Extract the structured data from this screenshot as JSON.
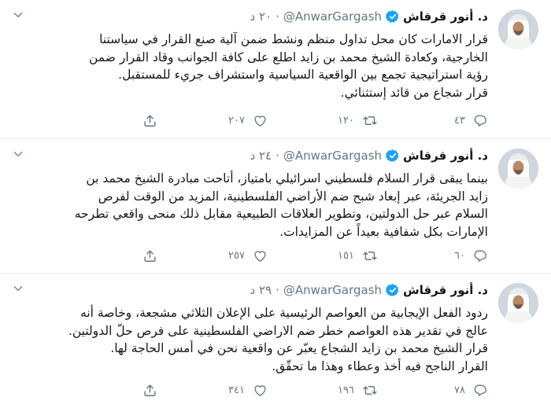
{
  "tweets": [
    {
      "name": "د. أنور قرقاش",
      "handle": "@AnwarGargash",
      "separator": "·",
      "time": "٢٠ د",
      "lines": [
        "قرار الامارات كان محل تداول منظم ونشط ضمن آلية صنع القرار في سياستنا",
        "الخارجية، وكعادة الشيخ محمد بن زايد اطلع على كافة الجوانب وقاد القرار ضمن",
        "رؤية استراتيجية تجمع بين الواقعية السياسية واستشراف جريء للمستقبل.",
        "قرار شجاع من قائد إستثنائي."
      ],
      "replies": "٤٣",
      "retweets": "١٢٠",
      "likes": "٢٠٧"
    },
    {
      "name": "د. أنور قرقاش",
      "handle": "@AnwarGargash",
      "separator": "·",
      "time": "٢٤ د",
      "lines": [
        "بينما يبقى قرار السلام فلسطيني اسرائيلي بامتياز، أتاحت مبادرة الشيخ محمد بن",
        "زايد الجريئة، عبر إبعاد شبح ضم الأراضي الفلسطينية، المزيد من الوقت لفرص",
        "السلام عبر حل الدولتين، وتطوير العلاقات الطبيعية مقابل ذلك منحى واقعي تطرحه",
        "الإمارات بكل شفافية بعيداً عن المزايدات."
      ],
      "replies": "٦٠",
      "retweets": "١٥١",
      "likes": "٢٥٧"
    },
    {
      "name": "د. أنور قرقاش",
      "handle": "@AnwarGargash",
      "separator": "·",
      "time": "٢٩ د",
      "lines": [
        "ردود الفعل الإيجابية من العواصم الرئيسية على الإعلان الثلاثي مشجعة، وخاصة أنه",
        "عالج في تقدير هذه العواصم خطر ضم الاراضي الفلسطينية على فرص حلّ الدولتين.",
        "قرار الشيخ محمد بن زايد الشجاع يعبّر عن واقعية نحن في أمس الحاجة لها.",
        "القرار الناجح فيه أخذ وعطاء وهذا ما تحقّق."
      ],
      "replies": "٧٨",
      "retweets": "١٩٦",
      "likes": "٣٤١"
    }
  ],
  "colors": {
    "text": "#14171a",
    "secondary": "#657786",
    "verified": "#1da1f2",
    "divider": "#e6ecf0"
  },
  "icons": [
    "verified-icon",
    "chevron-down-icon",
    "reply-icon",
    "retweet-icon",
    "like-icon",
    "share-icon"
  ]
}
